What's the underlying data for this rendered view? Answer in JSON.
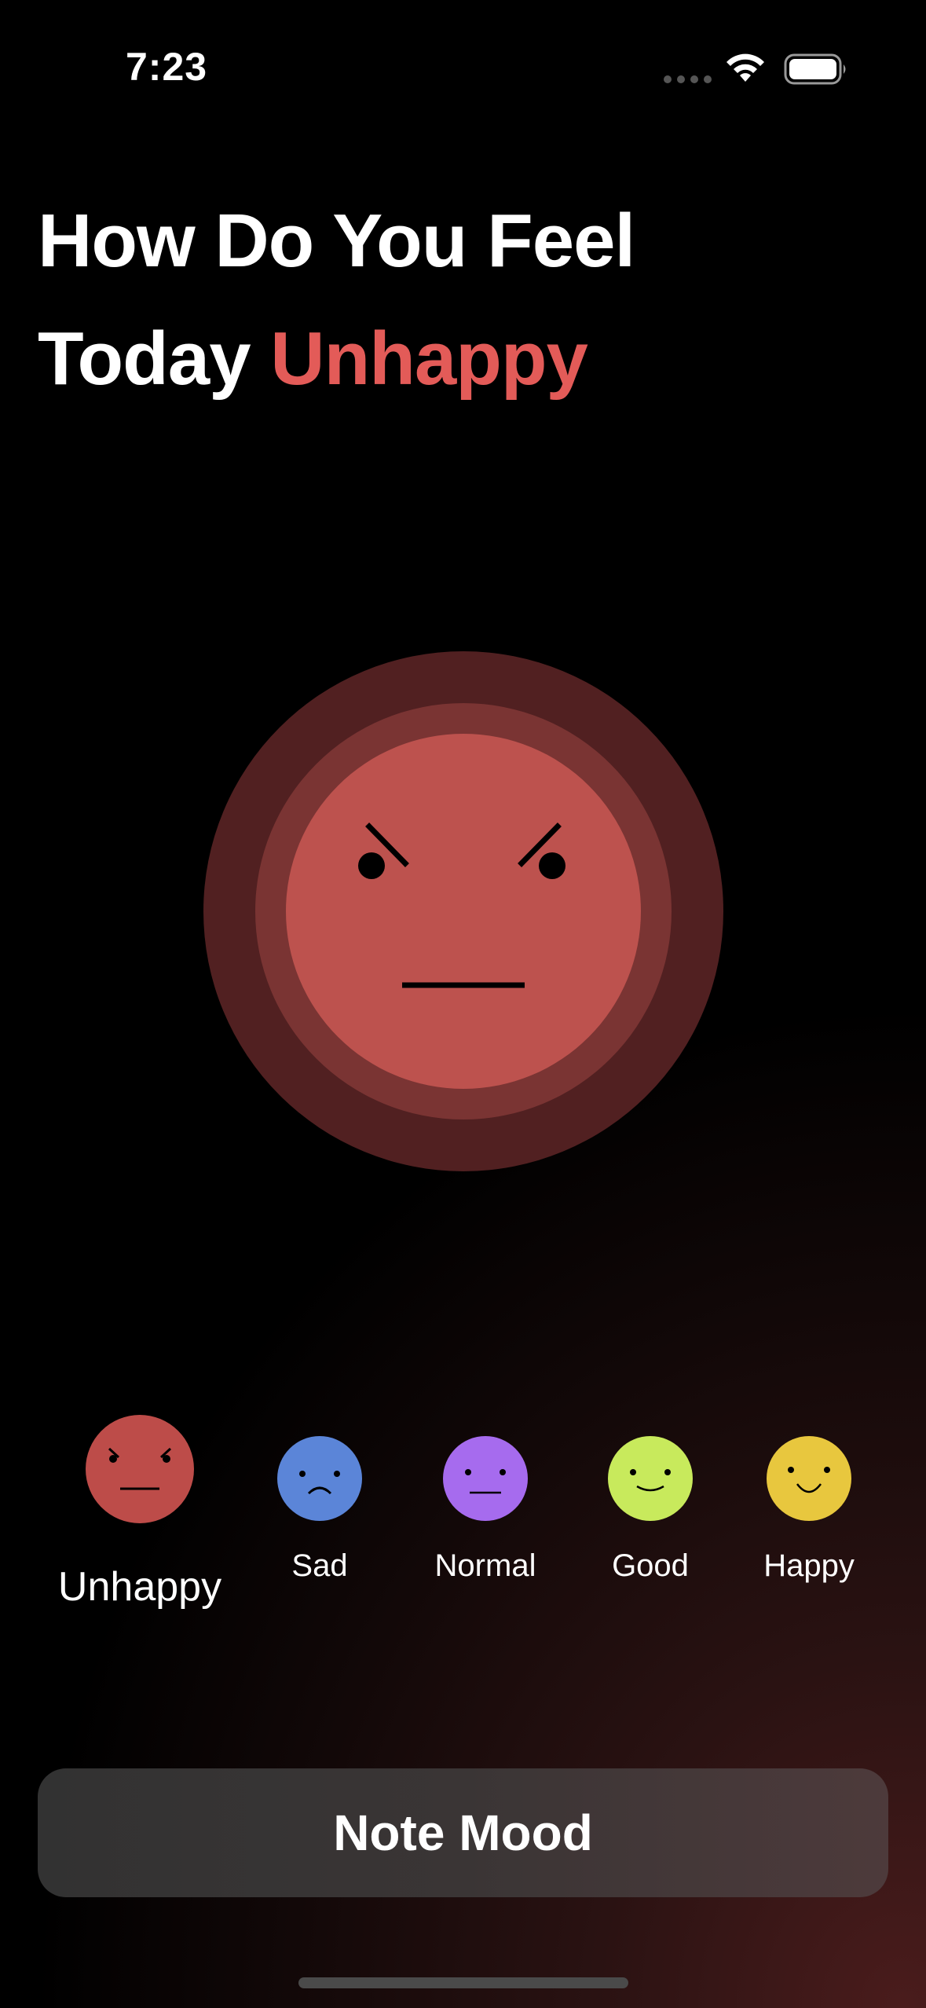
{
  "status_bar": {
    "time": "7:23",
    "icons": [
      "cellular-dots-icon",
      "wifi-icon",
      "battery-icon"
    ]
  },
  "header": {
    "title_line1": "How Do You Feel",
    "title_prefix": "Today",
    "title_mood": "Unhappy",
    "accent_color": "#e35b58"
  },
  "selected_mood": {
    "name": "Unhappy",
    "face_color": "#bd524e",
    "face_icon": "angry-face-icon"
  },
  "moods": [
    {
      "label": "Unhappy",
      "color": "#bd4c49",
      "icon": "angry-face-icon",
      "selected": true
    },
    {
      "label": "Sad",
      "color": "#5b85d8",
      "icon": "sad-face-icon",
      "selected": false
    },
    {
      "label": "Normal",
      "color": "#a66bee",
      "icon": "neutral-face-icon",
      "selected": false
    },
    {
      "label": "Good",
      "color": "#c8ea5c",
      "icon": "slight-smile-face-icon",
      "selected": false
    },
    {
      "label": "Happy",
      "color": "#e8c73e",
      "icon": "smile-face-icon",
      "selected": false
    }
  ],
  "actions": {
    "note_mood_label": "Note Mood"
  }
}
